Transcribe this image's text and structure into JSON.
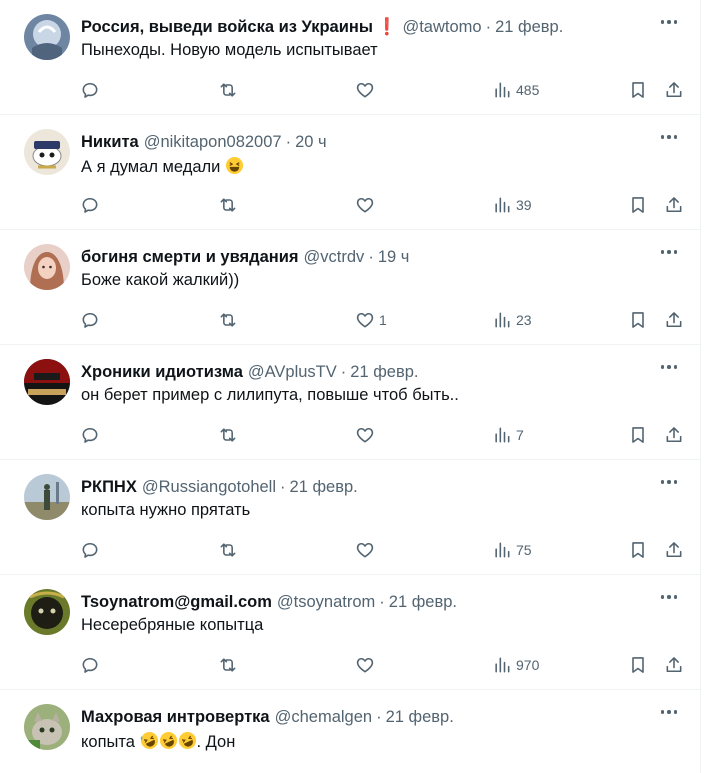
{
  "tweets": [
    {
      "name": "Россия, выведи войска из Украины",
      "flag": "❗",
      "handle": "@tawtomo",
      "time": "21 февр.",
      "text": "Пынеходы. Новую модель испытывает",
      "emoji_after": "",
      "likes": "",
      "views": "485",
      "avatar_color": "#7b8ea8"
    },
    {
      "name": "Никита",
      "flag": "",
      "handle": "@nikitapon082007",
      "time": "20 ч",
      "text": "А я думал медали ",
      "emoji_after": "laughing-face",
      "likes": "",
      "views": "39",
      "avatar_color": "#e9e4d8"
    },
    {
      "name": "богиня смерти и увядания",
      "flag": "",
      "handle": "@vctrdv",
      "time": "19 ч",
      "text": "Боже какой жалкий))",
      "emoji_after": "",
      "likes": "1",
      "views": "23",
      "avatar_color": "#d2a79a"
    },
    {
      "name": "Хроники идиотизма",
      "flag": "",
      "handle": "@AVplusTV",
      "time": "21 февр.",
      "text": "он берет пример с лилипута, повыше чтоб быть..",
      "emoji_after": "",
      "likes": "",
      "views": "7",
      "avatar_color": "#7a1414"
    },
    {
      "name": "РКПНХ",
      "flag": "",
      "handle": "@Russiangotohell",
      "time": "21 февр.",
      "text": "копыта нужно прятать",
      "emoji_after": "",
      "likes": "",
      "views": "75",
      "avatar_color": "#a7b8c6"
    },
    {
      "name": "Tsoynatrom@gmail.com",
      "flag": "",
      "handle": "@tsoynatrom",
      "time": "21 февр.",
      "text": "Несеребряные копытца",
      "emoji_after": "",
      "likes": "",
      "views": "970",
      "avatar_color": "#4a5a20"
    },
    {
      "name": "Махровая интровертка",
      "flag": "",
      "handle": "@chemalgen",
      "time": "21 февр.",
      "text": "копыта ",
      "emoji_after": "rofl-face-x3",
      "text_tail": ". Дон",
      "likes": "",
      "views": "",
      "avatar_color": "#8fa66a"
    }
  ],
  "icons": {
    "reply": "reply-icon",
    "retweet": "retweet-icon",
    "like": "heart-icon",
    "views": "views-icon",
    "bookmark": "bookmark-icon",
    "share": "share-icon",
    "more": "more-icon"
  },
  "colors": {
    "text": "#0f1419",
    "secondary": "#536471",
    "divider": "#eff3f4",
    "flag": "#d0021b"
  }
}
